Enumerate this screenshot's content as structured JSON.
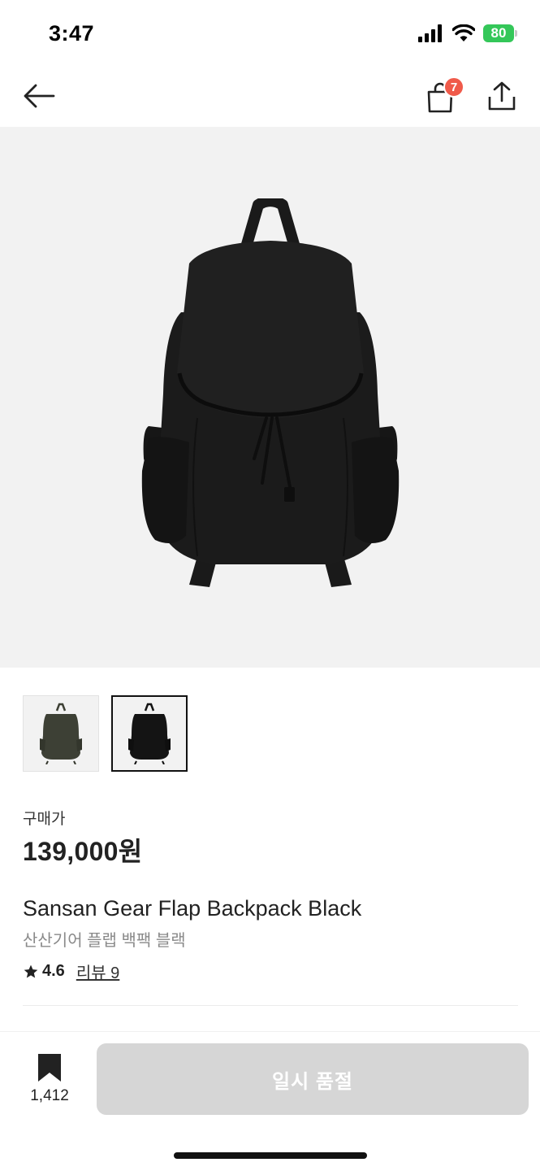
{
  "status_bar": {
    "time": "3:47",
    "battery": "80",
    "icons": [
      "cellular-signal-icon",
      "wifi-icon",
      "battery-icon"
    ]
  },
  "header": {
    "icons": [
      "back-arrow-icon",
      "shopping-bag-icon",
      "share-icon"
    ],
    "cart_badge": "7"
  },
  "product": {
    "price_label": "구매가",
    "price": "139,000원",
    "name_en": "Sansan Gear Flap Backpack Black",
    "name_ko": "산산기어 플랩 백팩 블랙",
    "rating": "4.6",
    "review_link": "리뷰 9",
    "thumbnails": [
      {
        "color_name": "olive",
        "color": "#3d4035",
        "selected": false
      },
      {
        "color_name": "black",
        "color": "#141414",
        "selected": true
      }
    ]
  },
  "bottom_bar": {
    "bookmark_count": "1,412",
    "soldout_label": "일시 품절"
  },
  "colors": {
    "accent_badge": "#f05a4a",
    "disabled_button": "#d6d6d6",
    "battery_green": "#34c759",
    "image_background": "#f2f2f2"
  }
}
